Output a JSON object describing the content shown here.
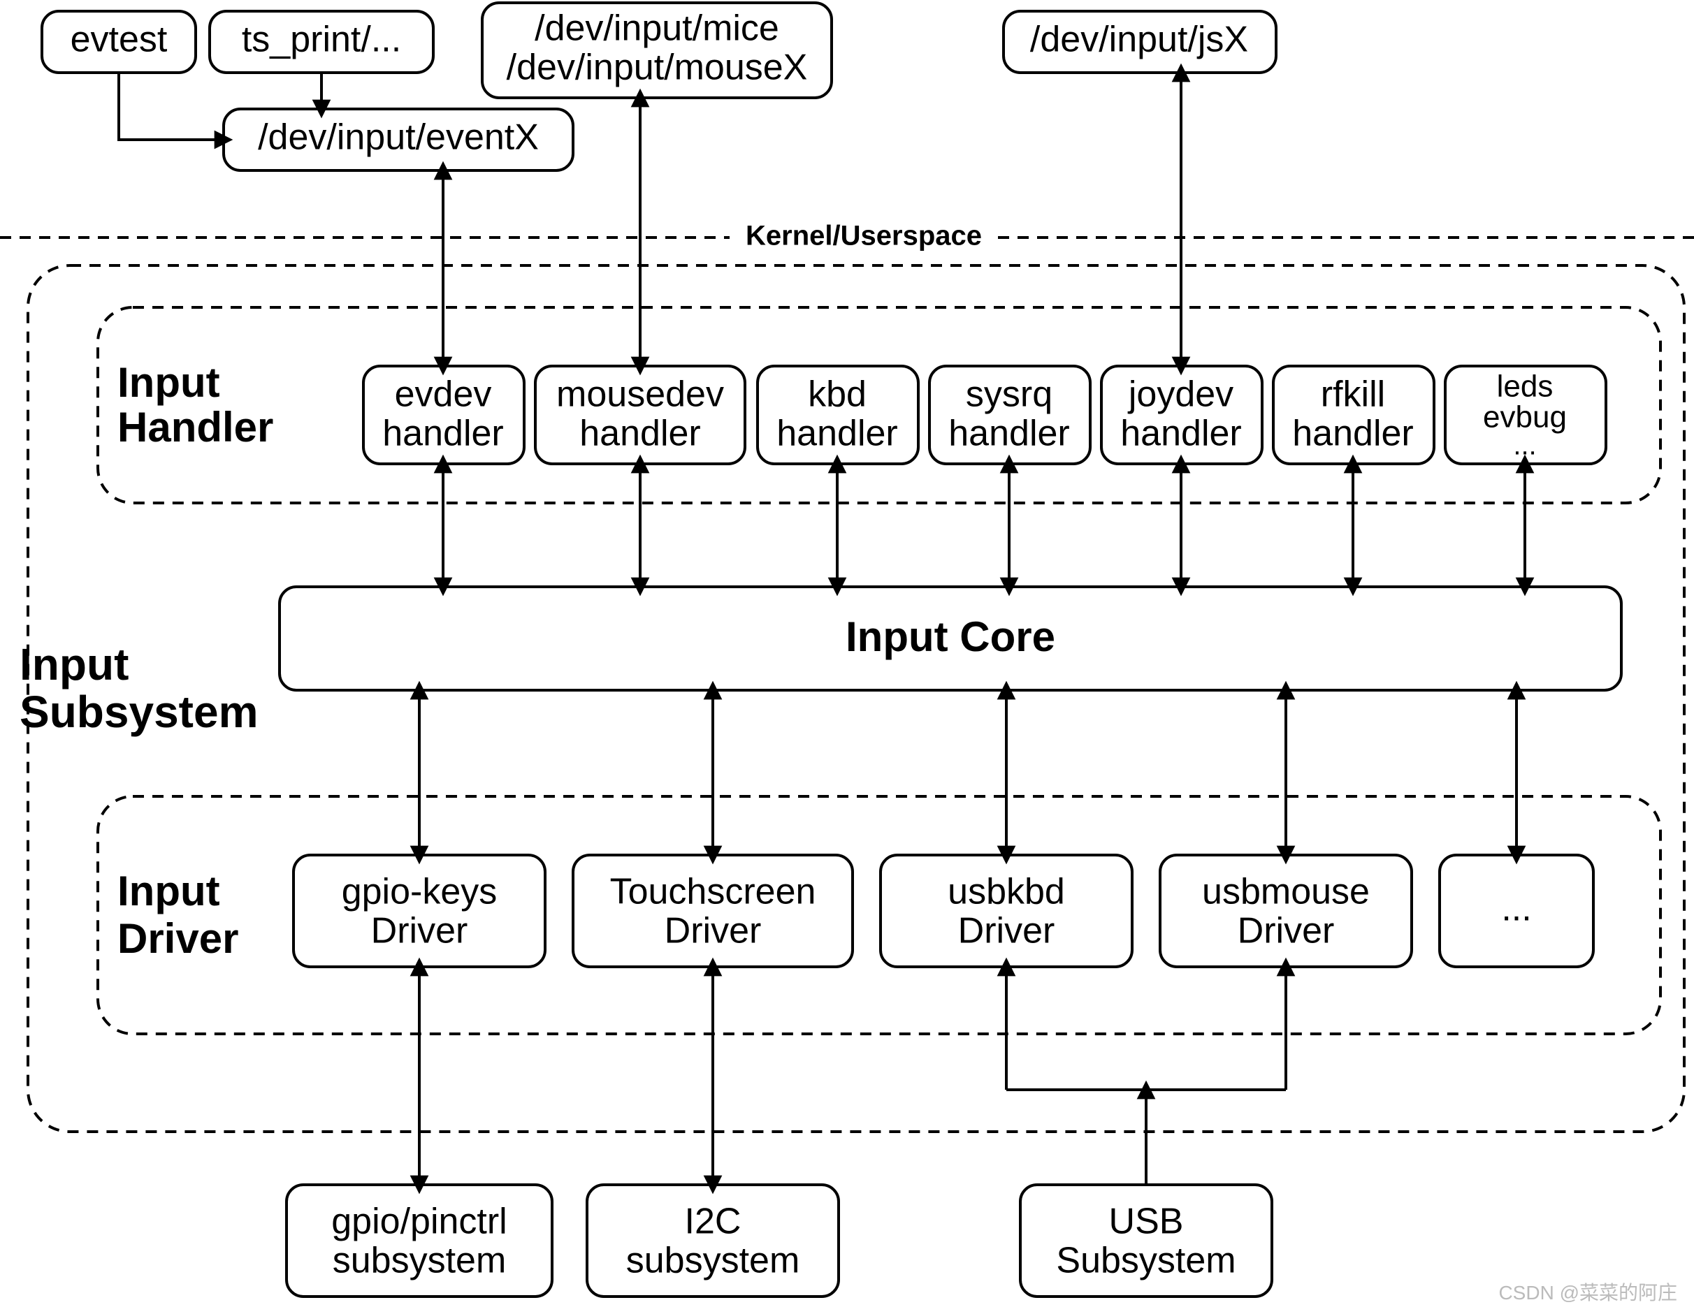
{
  "userspace": {
    "evtest": "evtest",
    "tsprint": "ts_print/...",
    "eventx": "/dev/input/eventX",
    "mice1": "/dev/input/mice",
    "mice2": "/dev/input/mouseX",
    "jsx": "/dev/input/jsX"
  },
  "divider": "Kernel/Userspace",
  "handler": {
    "label": "Input\nHandler",
    "evdev1": "evdev",
    "evdev2": "handler",
    "mouse1": "mousedev",
    "mouse2": "handler",
    "kbd1": "kbd",
    "kbd2": "handler",
    "sysrq1": "sysrq",
    "sysrq2": "handler",
    "joy1": "joydev",
    "joy2": "handler",
    "rfkill1": "rfkill",
    "rfkill2": "handler",
    "leds1": "leds",
    "leds2": "evbug",
    "leds3": "..."
  },
  "core": "Input Core",
  "subsystem_label": "Input\nSubsystem",
  "driver": {
    "label": "Input\nDriver",
    "gpio1": "gpio-keys",
    "gpio2": "Driver",
    "ts1": "Touchscreen",
    "ts2": "Driver",
    "usbkbd1": "usbkbd",
    "usbkbd2": "Driver",
    "usbm1": "usbmouse",
    "usbm2": "Driver",
    "more": "..."
  },
  "bottom": {
    "gpio1": "gpio/pinctrl",
    "gpio2": "subsystem",
    "i2c1": "I2C",
    "i2c2": "subsystem",
    "usb1": "USB",
    "usb2": "Subsystem"
  },
  "watermark": "CSDN @菜菜的阿庄"
}
